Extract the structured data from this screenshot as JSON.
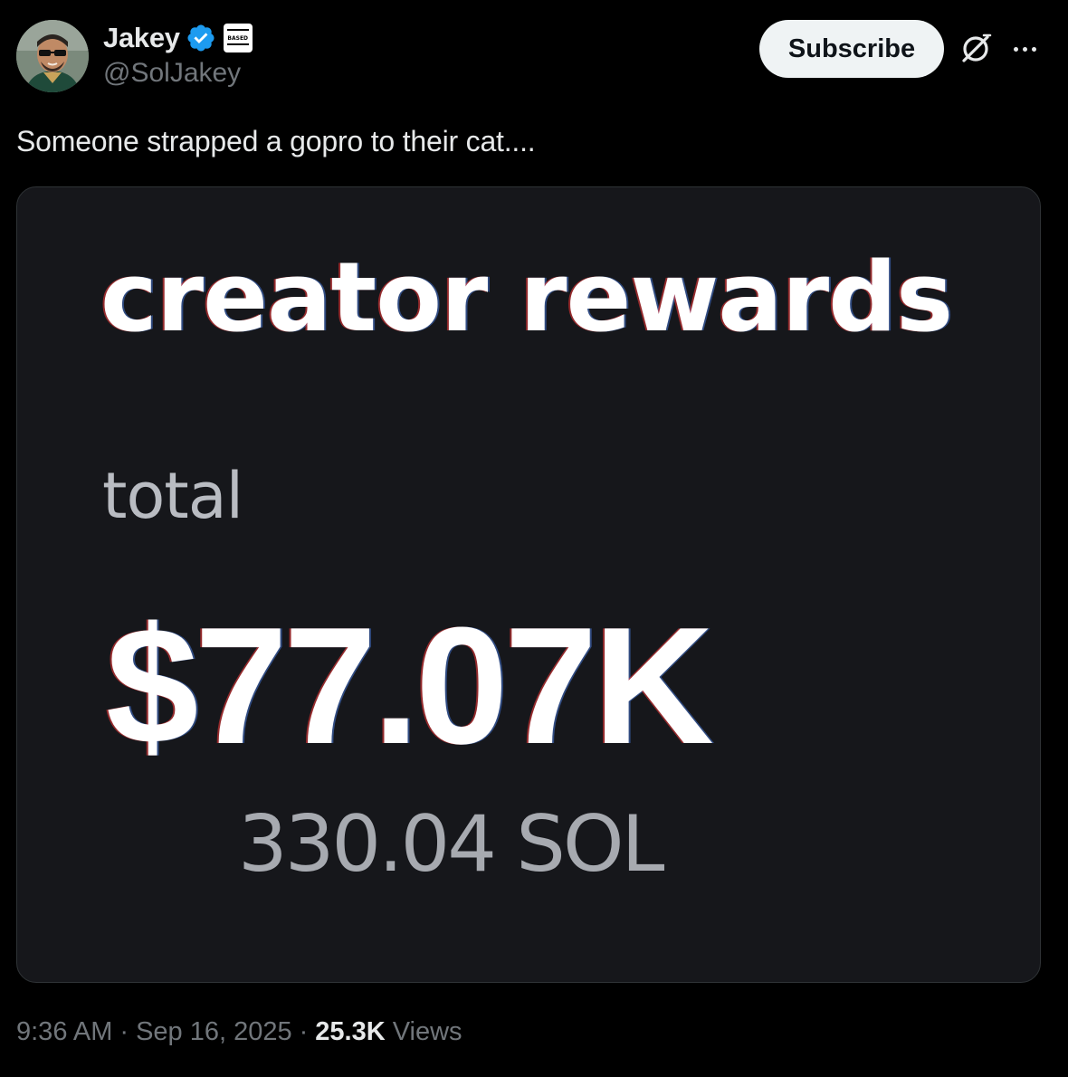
{
  "author": {
    "display_name": "Jakey",
    "handle": "@SolJakey",
    "verified": true,
    "affiliate_badge_text": "BASED",
    "avatar_icon": "user-avatar"
  },
  "actions": {
    "subscribe_label": "Subscribe",
    "grok_icon": "grok-icon",
    "more_icon": "more-icon"
  },
  "tweet": {
    "text": "Someone strapped a gopro to their cat...."
  },
  "media": {
    "heading": "creator rewards",
    "label": "total",
    "amount": "$77.07K",
    "sol_amount": "330.04 SOL"
  },
  "meta": {
    "time": "9:36 AM",
    "separator": "·",
    "date": "Sep 16, 2025",
    "views_count": "25.3K",
    "views_label": "Views"
  },
  "colors": {
    "background": "#000000",
    "text_primary": "#e7e9ea",
    "text_secondary": "#71767b",
    "verified_blue": "#1d9bf0",
    "card_background": "#16171b"
  }
}
